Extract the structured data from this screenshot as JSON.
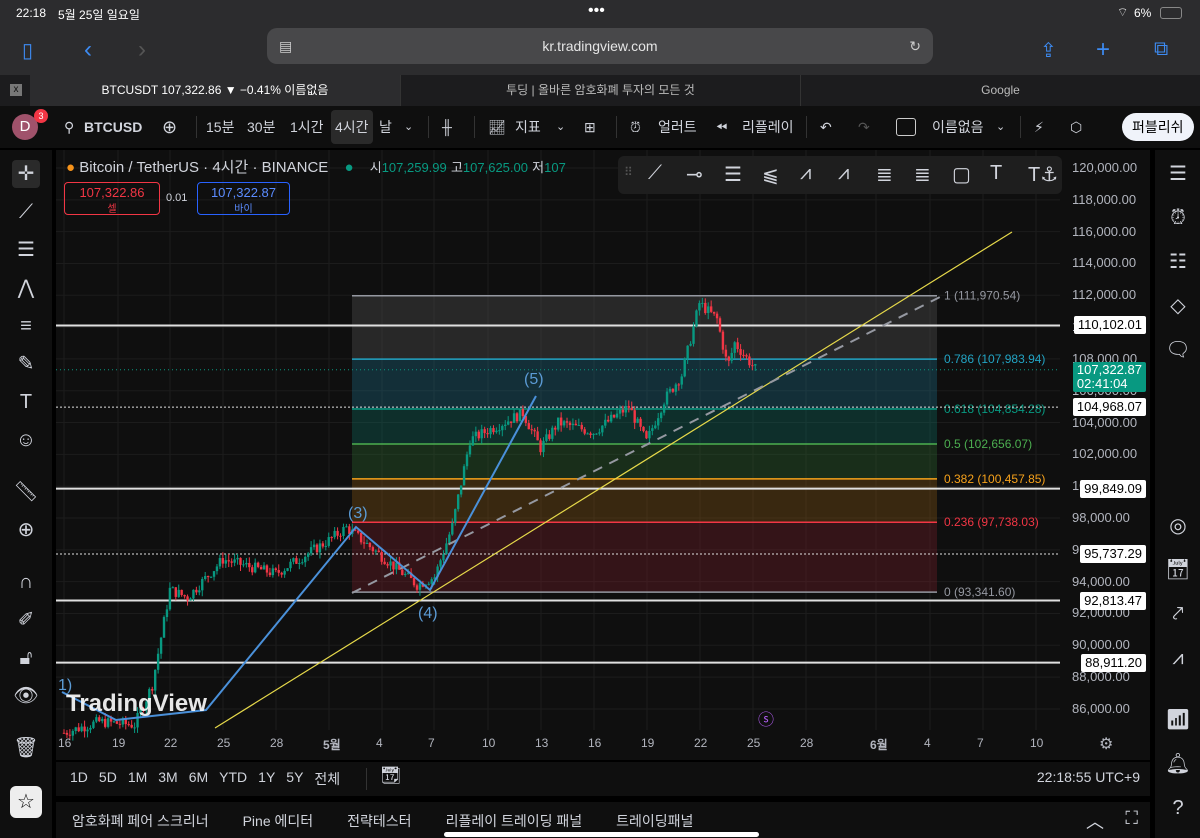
{
  "status": {
    "time": "22:18",
    "date": "5월 25일 일요일",
    "battery": "6%"
  },
  "browser": {
    "url": "kr.tradingview.com",
    "tabs": [
      {
        "label": "BTCUSDT 107,322.86 ▼ −0.41% 이름없음",
        "active": true
      },
      {
        "label": "투딩 | 올바른 암호화폐 투자의 모든 것"
      },
      {
        "label": "Google"
      }
    ],
    "close_tab": "x"
  },
  "toolbar": {
    "avatar": "D",
    "badge": "3",
    "symbol": "BTCUSD",
    "intervals": [
      "15분",
      "30분",
      "1시간",
      "4시간",
      "날"
    ],
    "active_interval": "4시간",
    "indicators": "지표",
    "alert": "얼러트",
    "replay": "리플레이",
    "layout_name": "이름없음",
    "publish": "퍼블리쉬"
  },
  "legend": {
    "title": "Bitcoin / TetherUS · 4시간 · BINANCE",
    "open_label": "시",
    "open": "107,259.99",
    "high_label": "고",
    "high": "107,625.00",
    "low_label": "저",
    "low": "107",
    "sell_price": "107,322.86",
    "sell_label": "셀",
    "spread": "0.01",
    "buy_price": "107,322.87",
    "buy_label": "바이"
  },
  "chart_data": {
    "type": "candlestick",
    "price_axis": [
      "120,000.00",
      "118,000.00",
      "116,000.00",
      "114,000.00",
      "112,000.00",
      "110,000.00",
      "108,000.00",
      "106,000.00",
      "104,000.00",
      "102,000.00",
      "100,000.00",
      "98,000.00",
      "96,000.00",
      "94,000.00",
      "92,000.00",
      "90,000.00",
      "88,000.00",
      "86,000.00"
    ],
    "ylim": [
      84800,
      120000
    ],
    "time_axis": [
      "16",
      "19",
      "22",
      "25",
      "28",
      "5월",
      "4",
      "7",
      "10",
      "13",
      "16",
      "19",
      "22",
      "25",
      "28",
      "6월",
      "4",
      "7",
      "10"
    ],
    "price_path": [
      [
        0,
        84500
      ],
      [
        2,
        85200
      ],
      [
        4,
        85000
      ],
      [
        5,
        87500
      ],
      [
        6,
        93500
      ],
      [
        7,
        93000
      ],
      [
        9,
        95400
      ],
      [
        12,
        94500
      ],
      [
        15,
        96600
      ],
      [
        16,
        97400
      ],
      [
        20,
        93800
      ],
      [
        21,
        94300
      ],
      [
        22,
        97500
      ],
      [
        23,
        102900
      ],
      [
        24,
        103500
      ],
      [
        26,
        104600
      ],
      [
        27,
        102400
      ],
      [
        28,
        104000
      ],
      [
        30,
        103400
      ],
      [
        32,
        105000
      ],
      [
        33,
        102800
      ],
      [
        34,
        105400
      ],
      [
        35,
        107000
      ],
      [
        36,
        111500
      ],
      [
        37,
        110500
      ],
      [
        37.6,
        107500
      ],
      [
        38,
        109000
      ],
      [
        39.2,
        107322.87
      ]
    ],
    "current_price": "107,322.87",
    "countdown": "02:41:04",
    "horizontal_lines": [
      {
        "value": 110102.01,
        "label": "110,102.01",
        "style": "solid"
      },
      {
        "value": 104968.07,
        "label": "104,968.07",
        "style": "dotted"
      },
      {
        "value": 99849.09,
        "label": "99,849.09",
        "style": "solid"
      },
      {
        "value": 95737.29,
        "label": "95,737.29",
        "style": "dotted"
      },
      {
        "value": 92813.47,
        "label": "92,813.47",
        "style": "solid"
      },
      {
        "value": 88911.2,
        "label": "88,911.20",
        "style": "solid"
      }
    ],
    "fib_levels": [
      {
        "ratio": "1",
        "value": 111970.54,
        "label": "1 (111,970.54)",
        "color": "#9598a1"
      },
      {
        "ratio": "0.786",
        "value": 107983.94,
        "label": "0.786 (107,983.94)",
        "color": "#22a4c4"
      },
      {
        "ratio": "0.618",
        "value": 104854.28,
        "label": "0.618 (104,854.28)",
        "color": "#089981"
      },
      {
        "ratio": "0.5",
        "value": 102656.07,
        "label": "0.5 (102,656.07)",
        "color": "#4caf50"
      },
      {
        "ratio": "0.382",
        "value": 100457.85,
        "label": "0.382 (100,457.85)",
        "color": "#f7a21b"
      },
      {
        "ratio": "0.236",
        "value": 97738.03,
        "label": "0.236 (97,738.03)",
        "color": "#f23645"
      },
      {
        "ratio": "0",
        "value": 93341.6,
        "label": "0 (93,341.60)",
        "color": "#9598a1"
      }
    ],
    "elliott_labels": [
      "1)",
      "(3)",
      "(4)",
      "(5)"
    ],
    "watermark": "TradingView",
    "colors": {
      "up": "#089981",
      "down": "#f23645",
      "trendline": "#e6d94a",
      "wave": "#4a90d9"
    }
  },
  "ranges": {
    "items": [
      "1D",
      "5D",
      "1M",
      "3M",
      "6M",
      "YTD",
      "1Y",
      "5Y",
      "전체"
    ],
    "clock": "22:18:55 UTC+9"
  },
  "panel": {
    "tabs": [
      "암호화폐 페어 스크리너",
      "Pine 에디터",
      "전략테스터",
      "리플레이 트레이딩 패널",
      "트레이딩패널"
    ]
  }
}
